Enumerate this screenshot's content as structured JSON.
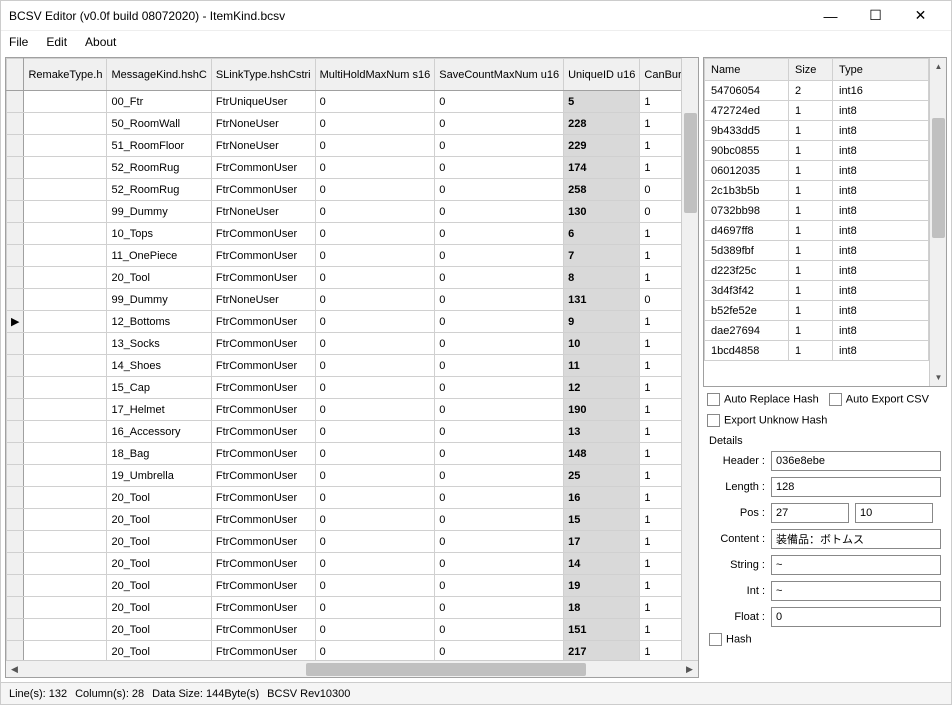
{
  "window": {
    "title": "BCSV Editor (v0.0f build 08072020) - ItemKind.bcsv"
  },
  "menu": [
    "File",
    "Edit",
    "About"
  ],
  "main_table": {
    "columns": [
      "RemakeType.h",
      "MessageKind.hshC",
      "SLinkType.hshCstri",
      "MultiHoldMaxNum s16",
      "SaveCountMaxNum u16",
      "UniqueID u16",
      "CanBury"
    ],
    "rows": [
      {
        "rh": "",
        "c": [
          "",
          "00_Ftr",
          "FtrUniqueUser",
          "0",
          "0",
          "5",
          "1"
        ]
      },
      {
        "rh": "",
        "c": [
          "",
          "50_RoomWall",
          "FtrNoneUser",
          "0",
          "0",
          "228",
          "1"
        ]
      },
      {
        "rh": "",
        "c": [
          "",
          "51_RoomFloor",
          "FtrNoneUser",
          "0",
          "0",
          "229",
          "1"
        ]
      },
      {
        "rh": "",
        "c": [
          "",
          "52_RoomRug",
          "FtrCommonUser",
          "0",
          "0",
          "174",
          "1"
        ]
      },
      {
        "rh": "",
        "c": [
          "",
          "52_RoomRug",
          "FtrCommonUser",
          "0",
          "0",
          "258",
          "0"
        ]
      },
      {
        "rh": "",
        "c": [
          "",
          "99_Dummy",
          "FtrNoneUser",
          "0",
          "0",
          "130",
          "0"
        ]
      },
      {
        "rh": "",
        "c": [
          "",
          "10_Tops",
          "FtrCommonUser",
          "0",
          "0",
          "6",
          "1"
        ]
      },
      {
        "rh": "",
        "c": [
          "",
          "11_OnePiece",
          "FtrCommonUser",
          "0",
          "0",
          "7",
          "1"
        ]
      },
      {
        "rh": "",
        "c": [
          "",
          "20_Tool",
          "FtrCommonUser",
          "0",
          "0",
          "8",
          "1"
        ]
      },
      {
        "rh": "",
        "c": [
          "",
          "99_Dummy",
          "FtrNoneUser",
          "0",
          "0",
          "131",
          "0"
        ]
      },
      {
        "rh": "▶",
        "c": [
          "",
          "12_Bottoms",
          "FtrCommonUser",
          "0",
          "0",
          "9",
          "1"
        ]
      },
      {
        "rh": "",
        "c": [
          "",
          "13_Socks",
          "FtrCommonUser",
          "0",
          "0",
          "10",
          "1"
        ]
      },
      {
        "rh": "",
        "c": [
          "",
          "14_Shoes",
          "FtrCommonUser",
          "0",
          "0",
          "11",
          "1"
        ]
      },
      {
        "rh": "",
        "c": [
          "",
          "15_Cap",
          "FtrCommonUser",
          "0",
          "0",
          "12",
          "1"
        ]
      },
      {
        "rh": "",
        "c": [
          "",
          "17_Helmet",
          "FtrCommonUser",
          "0",
          "0",
          "190",
          "1"
        ]
      },
      {
        "rh": "",
        "c": [
          "",
          "16_Accessory",
          "FtrCommonUser",
          "0",
          "0",
          "13",
          "1"
        ]
      },
      {
        "rh": "",
        "c": [
          "",
          "18_Bag",
          "FtrCommonUser",
          "0",
          "0",
          "148",
          "1"
        ]
      },
      {
        "rh": "",
        "c": [
          "",
          "19_Umbrella",
          "FtrCommonUser",
          "0",
          "0",
          "25",
          "1"
        ]
      },
      {
        "rh": "",
        "c": [
          "",
          "20_Tool",
          "FtrCommonUser",
          "0",
          "0",
          "16",
          "1"
        ]
      },
      {
        "rh": "",
        "c": [
          "",
          "20_Tool",
          "FtrCommonUser",
          "0",
          "0",
          "15",
          "1"
        ]
      },
      {
        "rh": "",
        "c": [
          "",
          "20_Tool",
          "FtrCommonUser",
          "0",
          "0",
          "17",
          "1"
        ]
      },
      {
        "rh": "",
        "c": [
          "",
          "20_Tool",
          "FtrCommonUser",
          "0",
          "0",
          "14",
          "1"
        ]
      },
      {
        "rh": "",
        "c": [
          "",
          "20_Tool",
          "FtrCommonUser",
          "0",
          "0",
          "19",
          "1"
        ]
      },
      {
        "rh": "",
        "c": [
          "",
          "20_Tool",
          "FtrCommonUser",
          "0",
          "0",
          "18",
          "1"
        ]
      },
      {
        "rh": "",
        "c": [
          "",
          "20_Tool",
          "FtrCommonUser",
          "0",
          "0",
          "151",
          "1"
        ]
      },
      {
        "rh": "",
        "c": [
          "",
          "20_Tool",
          "FtrCommonUser",
          "0",
          "0",
          "217",
          "1"
        ]
      }
    ]
  },
  "side_table": {
    "columns": [
      "Name",
      "Size",
      "Type"
    ],
    "rows": [
      [
        "54706054",
        "2",
        "int16"
      ],
      [
        "472724ed",
        "1",
        "int8"
      ],
      [
        "9b433dd5",
        "1",
        "int8"
      ],
      [
        "90bc0855",
        "1",
        "int8"
      ],
      [
        "06012035",
        "1",
        "int8"
      ],
      [
        "2c1b3b5b",
        "1",
        "int8"
      ],
      [
        "0732bb98",
        "1",
        "int8"
      ],
      [
        "d4697ff8",
        "1",
        "int8"
      ],
      [
        "5d389fbf",
        "1",
        "int8"
      ],
      [
        "d223f25c",
        "1",
        "int8"
      ],
      [
        "3d4f3f42",
        "1",
        "int8"
      ],
      [
        "b52fe52e",
        "1",
        "int8"
      ],
      [
        "dae27694",
        "1",
        "int8"
      ],
      [
        "1bcd4858",
        "1",
        "int8"
      ]
    ]
  },
  "checkboxes": {
    "auto_replace": "Auto Replace Hash",
    "auto_export": "Auto Export CSV",
    "export_unknown": "Export Unknow Hash"
  },
  "details": {
    "group": "Details",
    "labels": {
      "header": "Header :",
      "length": "Length :",
      "pos": "Pos :",
      "content": "Content :",
      "string": "String :",
      "int": "Int :",
      "float": "Float :",
      "hash": "Hash"
    },
    "values": {
      "header": "036e8ebe",
      "length": "128",
      "pos1": "27",
      "pos2": "10",
      "content": "装備品：ボトムス",
      "string": "~",
      "int": "~",
      "float": "0"
    }
  },
  "status": {
    "lines": "Line(s): 132",
    "columns": "Column(s): 28",
    "datasize": "Data Size: 144Byte(s)",
    "rev": "BCSV Rev10300"
  }
}
